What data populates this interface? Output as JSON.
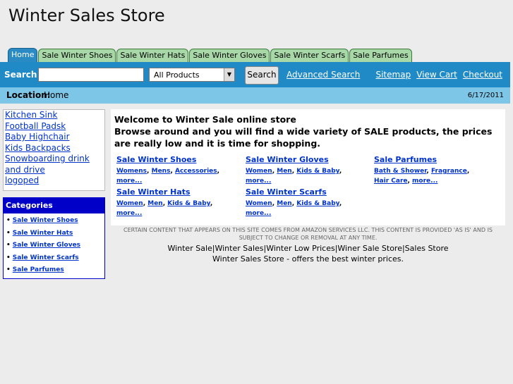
{
  "site": {
    "title": "Winter Sales Store"
  },
  "tabs": [
    "Home",
    "Sale Winter Shoes",
    "Sale Winter Hats",
    "Sale Winter Gloves",
    "Sale Winter Scarfs",
    "Sale Parfumes"
  ],
  "search": {
    "label": "Search",
    "value": "",
    "category": "All Products",
    "button": "Search",
    "advanced": "Advanced Search"
  },
  "header_links": [
    "Sitemap",
    "View Cart",
    "Checkout"
  ],
  "location": {
    "label": "Location:",
    "value": "Home",
    "date": "6/17/2011"
  },
  "left_links": [
    "Kitchen Sink",
    "Football Padsk",
    "Baby Highchair",
    "Kids Backpacks",
    "Snowboarding drink and drive",
    "logoped"
  ],
  "categories": {
    "title": "Categories",
    "items": [
      "Sale Winter Shoes",
      "Sale Winter Hats",
      "Sale Winter Gloves",
      "Sale Winter Scarfs",
      "Sale Parfumes"
    ]
  },
  "welcome": {
    "line1": "Welcome to Winter Sale online store",
    "line2": "Browse around and you will find a wide variety of SALE products, the prices are really low and it is time for shopping."
  },
  "product_groups": [
    {
      "title": "Sale Winter Shoes",
      "links": [
        "Womens",
        "Mens",
        "Accessories",
        "more..."
      ]
    },
    {
      "title": "Sale Winter Gloves",
      "links": [
        "Women",
        "Men",
        "Kids & Baby",
        "more..."
      ]
    },
    {
      "title": "Sale Parfumes",
      "links": [
        "Bath & Shower",
        "Fragrance",
        "Hair Care",
        "more..."
      ]
    },
    {
      "title": "Sale Winter Hats",
      "links": [
        "Women",
        "Men",
        "Kids & Baby",
        "more..."
      ]
    },
    {
      "title": "Sale Winter Scarfs",
      "links": [
        "Women",
        "Men",
        "Kids & Baby",
        "more..."
      ]
    }
  ],
  "disclaimer": "CERTAIN CONTENT THAT APPEARS ON THIS SITE COMES FROM AMAZON SERVICES LLC. THIS CONTENT IS PROVIDED 'AS IS' AND IS SUBJECT TO CHANGE OR REMOVAL AT ANY TIME.",
  "keywords": "Winter Sale|Winter Sales|Winter Low Prices|Winer Sale Store|Sales Store",
  "tagline": "Winter Sales Store - offers the best winter prices."
}
